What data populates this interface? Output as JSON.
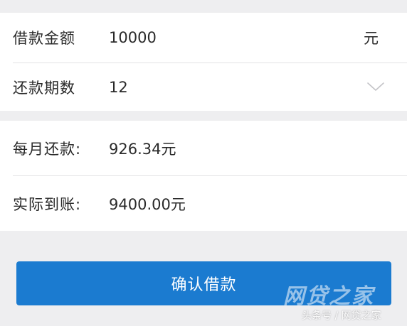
{
  "loan_form": {
    "amount": {
      "label": "借款金额",
      "value": "10000",
      "unit": "元"
    },
    "term": {
      "label": "还款期数",
      "value": "12",
      "icon": "chevron-down-icon"
    }
  },
  "result": {
    "monthly_payment": {
      "label": "每月还款:",
      "value": "926.34元"
    },
    "actual_received": {
      "label": "实际到账:",
      "value": "9400.00元"
    }
  },
  "actions": {
    "confirm_label": "确认借款"
  },
  "watermark": {
    "logo_text": "网贷之家",
    "caption": "头条号 / 网贷之家"
  },
  "colors": {
    "primary": "#1b7bd0",
    "background": "#eeeef0",
    "panel": "#ffffff",
    "text": "#2a2a2a",
    "divider": "#e2e2e4"
  }
}
